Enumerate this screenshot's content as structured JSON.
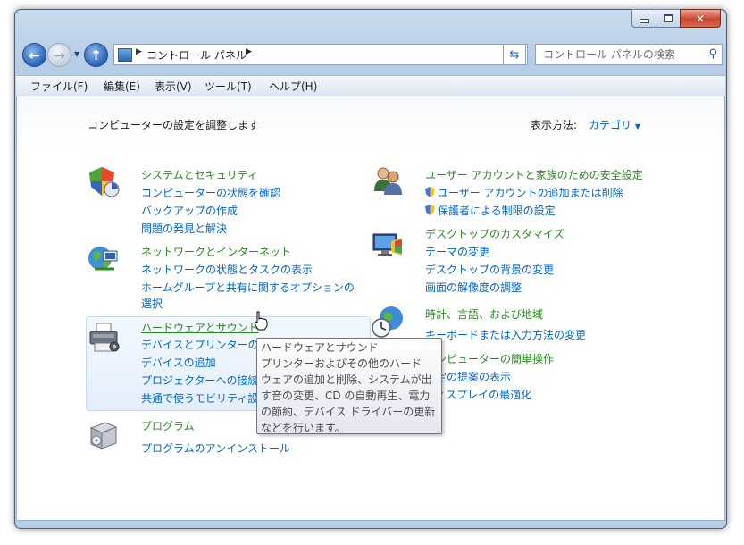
{
  "window": {
    "address": {
      "path": "コントロール パネル"
    },
    "search": {
      "placeholder": "コントロール パネルの検索"
    }
  },
  "menu": [
    "ファイル(F)",
    "編集(E)",
    "表示(V)",
    "ツール(T)",
    "ヘルプ(H)"
  ],
  "content": {
    "heading": "コンピューターの設定を調整します",
    "view_by_label": "表示方法:",
    "view_by_value": "カテゴリ",
    "left": [
      {
        "title": "システムとセキュリティ",
        "links": [
          "コンピューターの状態を確認",
          "バックアップの作成",
          "問題の発見と解決"
        ]
      },
      {
        "title": "ネットワークとインターネット",
        "links": [
          "ネットワークの状態とタスクの表示",
          "ホームグループと共有に関するオプションの",
          "選択"
        ]
      },
      {
        "title": "ハードウェアとサウンド",
        "links": [
          "デバイスとプリンターの表示",
          "デバイスの追加",
          "プロジェクターへの接続",
          "共通で使うモビリティ設定の調整"
        ]
      },
      {
        "title": "プログラム",
        "links": [
          "プログラムのアンインストール"
        ]
      }
    ],
    "right": [
      {
        "title": "ユーザー アカウントと家族のための安全設定",
        "links": [
          "ユーザー アカウントの追加または削除",
          "保護者による制限の設定"
        ]
      },
      {
        "title": "デスクトップのカスタマイズ",
        "links": [
          "テーマの変更",
          "デスクトップの背景の変更",
          "画面の解像度の調整"
        ]
      },
      {
        "title": "時計、言語、および地域",
        "links": [
          "キーボードまたは入力方法の変更"
        ]
      },
      {
        "title": "コンピューターの簡単操作",
        "links": [
          "設定の提案の表示",
          "ディスプレイの最適化"
        ]
      }
    ]
  },
  "tooltip": {
    "lines": [
      "ハードウェアとサウンド",
      "プリンターおよびその他のハード",
      "ウェアの追加と削除、システムが出",
      "す音の変更、CD の自動再生、電力",
      "の節約、デバイス ドライバーの更新",
      "などを行います。"
    ]
  },
  "icons": {
    "system": "shield-icon",
    "network": "globe-network-icon",
    "hardware": "printer-icon",
    "programs": "programs-box-icon",
    "users": "users-icon",
    "desktop": "desktop-icon",
    "clock": "clock-globe-icon"
  }
}
